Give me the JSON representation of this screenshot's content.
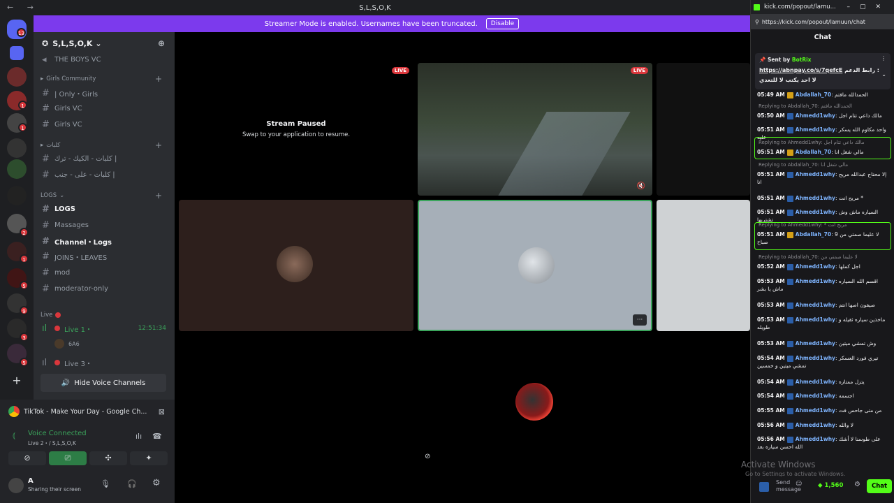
{
  "window": {
    "title": "S,L,S,O,K",
    "nav_glyphs": "← →"
  },
  "banner": {
    "text": "Streamer Mode is enabled. Usernames have been truncated.",
    "button": "Disable"
  },
  "rail_badges": [
    "13",
    "1",
    "1",
    "1",
    "2",
    "1",
    "5",
    "9",
    "3",
    "5"
  ],
  "server": {
    "name": "S,L,S,O,K",
    "chevron": "⌄"
  },
  "channels": {
    "boys": "THE BOYS VC",
    "cat_girls": "Girls Community",
    "girls_only": "| Only・Girls",
    "girls_vc1": "Girls VC",
    "girls_vc2": "Girls VC",
    "cat_arabic": "كلبات",
    "arabic1": "كلبات - الكيك - ترك |",
    "arabic2": "كلبات - على - جنب |",
    "cat_logs": "LOGS",
    "logs": "LOGS",
    "massages": "Massages",
    "channel_logs": "Channel・Logs",
    "joins": "JOINS・LEAVES",
    "mod": "mod",
    "moderator": "moderator-only",
    "cat_live": "Live",
    "live1": "Live 1・",
    "live1_time": "12:51:34",
    "live1_user": "6A6",
    "live3": "Live 3・",
    "hide_voice": "Hide Voice Channels"
  },
  "voice": {
    "tiktok": "TikTok - Make Your Day - Google Ch...",
    "connected": "Voice Connected",
    "location": "Live 2・/ S,L,S,O,K",
    "user_initial": "A",
    "user_status": "Sharing their screen"
  },
  "stage": {
    "paused_title": "Stream Paused",
    "paused_sub": "Swap to your application to resume.",
    "live_label": "LIVE",
    "more_glyph": "···"
  },
  "browser": {
    "tab_title": "kick.com/popout/lamu...",
    "url": "https://kick.com/popout/lamuun/chat",
    "header": "Chat",
    "pinned_sender_label": "Sent by",
    "pinned_sender": "BotRix",
    "pinned_link": "https://abnpay.co/s/7qefcE",
    "pinned_text": "رابط الدعم :",
    "pinned_text2": "لا احد يكتب لا للتعدي",
    "send_placeholder": "Send message",
    "points": "1,560",
    "chat_button": "Chat",
    "watermark1": "Activate Windows",
    "watermark2": "Go to Settings to activate Windows."
  },
  "chat": [
    {
      "time": "05:49 AM",
      "user": "Abdallah_70",
      "text": "الحمدالله مافتم",
      "reply": ""
    },
    {
      "time": "05:50 AM",
      "user": "Ahmedd1why",
      "text": "مالك داعي تتام اجل",
      "reply": "Replying to Abdallah_70: الحمدالله مافتم"
    },
    {
      "time": "05:51 AM",
      "user": "Ahmedd1why",
      "text": "واحد مكاوم الله يسكر عليه",
      "reply": ""
    },
    {
      "time": "05:51 AM",
      "user": "Abdallah_70",
      "text": "مالي شغل انا",
      "reply": "Replying to Ahmedd1why: مالك داعي تتام اجل"
    },
    {
      "time": "05:51 AM",
      "user": "Ahmedd1why",
      "text": "إلا محتاج عبدالله مريح انا",
      "reply": "Replying to Abdallah_70: مالي شغل انا"
    },
    {
      "time": "05:51 AM",
      "user": "Ahmedd1why",
      "text": "مريح انت *",
      "reply": ""
    },
    {
      "time": "05:51 AM",
      "user": "Ahmedd1why",
      "text": "السياره ماش وش تشتريها",
      "reply": ""
    },
    {
      "time": "05:51 AM",
      "user": "Abdallah_70",
      "text": "لا عليما صمتي من 9 صباح",
      "reply": "Replying to Ahmedd1why: * مريح انت"
    },
    {
      "time": "05:52 AM",
      "user": "Ahmedd1why",
      "text": "اجل كملها",
      "reply": "Replying to Abdallah_70: لا عليما صمتي من"
    },
    {
      "time": "05:53 AM",
      "user": "Ahmedd1why",
      "text": "اقسم الله السياره ماش يا بشر",
      "reply": ""
    },
    {
      "time": "05:53 AM",
      "user": "Ahmedd1why",
      "text": "صيفون اصها انتم",
      "reply": ""
    },
    {
      "time": "05:53 AM",
      "user": "Ahmedd1why",
      "text": "ماخذين سياره ثقيله و طويله",
      "reply": ""
    },
    {
      "time": "05:53 AM",
      "user": "Ahmedd1why",
      "text": "وش تمشي ميتين",
      "reply": ""
    },
    {
      "time": "05:54 AM",
      "user": "Ahmedd1why",
      "text": "تيري فورد العسكر تمشي ميتين و خمسين",
      "reply": ""
    },
    {
      "time": "05:54 AM",
      "user": "Ahmedd1why",
      "text": "يتزل ممتازه",
      "reply": ""
    },
    {
      "time": "05:54 AM",
      "user": "Ahmedd1why",
      "text": "اجسمه",
      "reply": ""
    },
    {
      "time": "05:55 AM",
      "user": "Ahmedd1why",
      "text": "من متى جاحس فت",
      "reply": ""
    },
    {
      "time": "05:56 AM",
      "user": "Ahmedd1why",
      "text": "لا والله",
      "reply": ""
    },
    {
      "time": "05:56 AM",
      "user": "Ahmedd1why",
      "text": "على طوسنا لا أشك الله احسن سياره بعد",
      "reply": ""
    }
  ],
  "colors": {
    "banner": "#7c3aed",
    "kick_green": "#53fc18",
    "live_red": "#da373c"
  }
}
